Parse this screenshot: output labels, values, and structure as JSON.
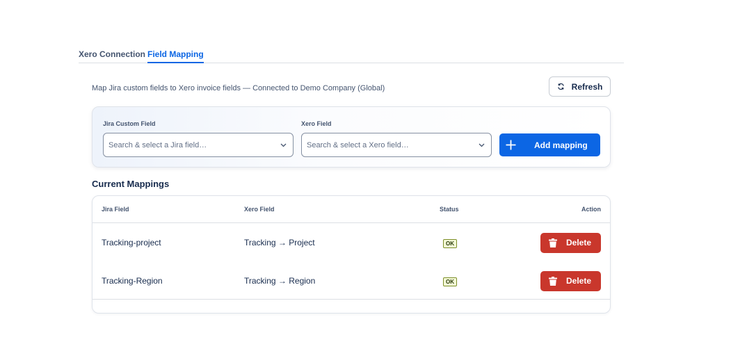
{
  "tabs": [
    {
      "label": "Xero Connection",
      "active": false
    },
    {
      "label": "Field Mapping",
      "active": true
    }
  ],
  "description": "Map Jira custom fields to Xero invoice fields — Connected to Demo Company (Global)",
  "refresh_label": "Refresh",
  "form": {
    "jira_label": "Jira Custom Field",
    "jira_placeholder": "Search & select a Jira field…",
    "xero_label": "Xero Field",
    "xero_placeholder": "Search & select a Xero field…",
    "add_label": "Add mapping"
  },
  "mappings_title": "Current Mappings",
  "table": {
    "headers": [
      "Jira Field",
      "Xero Field",
      "Status",
      "Action"
    ],
    "rows": [
      {
        "jira": "Tracking-project",
        "xero": "Tracking → Project",
        "status": "OK",
        "action": "Delete"
      },
      {
        "jira": "Tracking-Region",
        "xero": "Tracking → Region",
        "status": "OK",
        "action": "Delete"
      }
    ]
  },
  "colors": {
    "accent": "#0c66e4",
    "danger": "#c9372c",
    "ok_badge_border": "#7e8f2a",
    "ok_badge_bg": "#f3f9d6"
  },
  "icons": [
    "refresh-icon",
    "chevron-down-icon",
    "plus-icon",
    "trash-icon"
  ]
}
